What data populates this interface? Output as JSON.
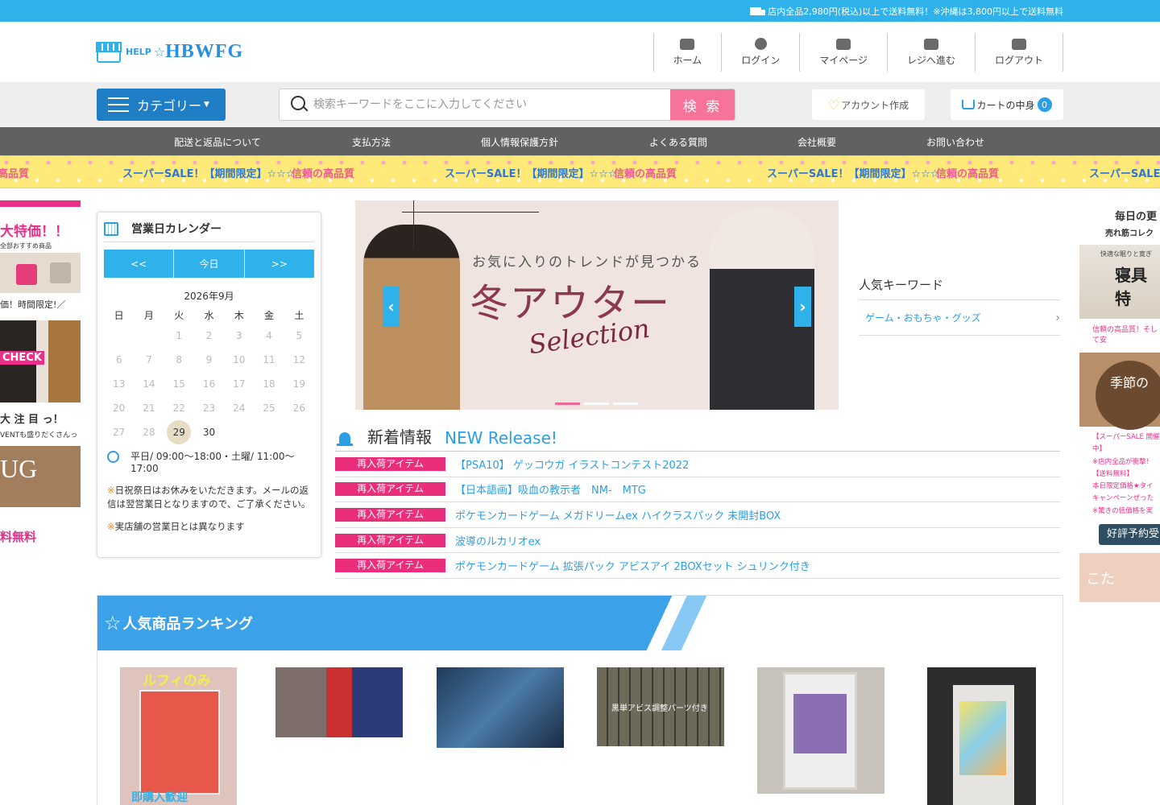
{
  "topbar": {
    "notice": "店内全品2,980円(税込)以上で送料無料！※沖縄は3,800円以上で送料無料"
  },
  "logo": {
    "help": "HELP",
    "star": "☆",
    "brand": "HBWFG"
  },
  "header_nav": [
    {
      "label": "ホーム",
      "icon": "home-icon"
    },
    {
      "label": "ログイン",
      "icon": "user-icon"
    },
    {
      "label": "マイページ",
      "icon": "id-card-icon"
    },
    {
      "label": "レジへ進む",
      "icon": "register-icon"
    },
    {
      "label": "ログアウト",
      "icon": "logout-icon"
    }
  ],
  "toolbar": {
    "category_label": "カテゴリー",
    "search_placeholder": "検索キーワードをここに入力してください",
    "search_button": "検 索",
    "account_label": "アカウント作成",
    "cart_label": "カートの中身",
    "cart_count": "0"
  },
  "global_nav": [
    "配送と返品について",
    "支払方法",
    "個人情報保護方針",
    "よくある質問",
    "会社概要",
    "お問い合わせ"
  ],
  "ribbon": {
    "a": "信頼の高品質",
    "b": "スーパーSALE！【期間限定】☆☆☆"
  },
  "left_strip": {
    "t1": "大特価！！",
    "s1": "全部おすすめ商品",
    "t2": "価！時間限定!／",
    "check": "CHECK",
    "t3": "大 注 目 っ！",
    "s2": "VENTも盛りだくさんっ",
    "rug": "UG",
    "free": "料無料"
  },
  "calendar": {
    "title": "営業日カレンダー",
    "prev": "<<",
    "today": "今日",
    "next": ">>",
    "month": "2026年9月",
    "weekdays": [
      "日",
      "月",
      "火",
      "水",
      "木",
      "金",
      "土"
    ],
    "weeks": [
      [
        "",
        "",
        "1",
        "2",
        "3",
        "4",
        "5"
      ],
      [
        "6",
        "7",
        "8",
        "9",
        "10",
        "11",
        "12"
      ],
      [
        "13",
        "14",
        "15",
        "16",
        "17",
        "18",
        "19"
      ],
      [
        "20",
        "21",
        "22",
        "23",
        "24",
        "25",
        "26"
      ],
      [
        "27",
        "28",
        "29",
        "30",
        "",
        "",
        ""
      ]
    ],
    "hours": "平日/ 09:00～18:00・土曜/ 11:00～17:00",
    "note_prefix": "※",
    "note": "日祝祭日はお休みをいただきます。メールの返信は翌営業日となりますので、ご了承ください。",
    "note2": "実店舗の営業日とは異なります"
  },
  "banner": {
    "sub": "お気に入りのトレンドが見つかる",
    "title": "冬アウター",
    "script": "Selection",
    "prev": "‹",
    "next": "›",
    "active_slide": 1,
    "slide_count": 3
  },
  "keywords": {
    "title": "人気キーワード",
    "items": [
      "ゲーム・おもちゃ・グッズ"
    ],
    "chevron": "›"
  },
  "news": {
    "title": "新着情報",
    "subtitle": "NEW Release!",
    "items": [
      {
        "tag": "再入荷アイテム",
        "text": "【PSA10】 ゲッコウガ イラストコンテスト2022"
      },
      {
        "tag": "再入荷アイテム",
        "text": "【日本語画】吸血の教示者　NM-　MTG"
      },
      {
        "tag": "再入荷アイテム",
        "text": "ポケモンカードゲーム メガドリームex ハイクラスパック 未開封BOX"
      },
      {
        "tag": "再入荷アイテム",
        "text": "波導のルカリオex"
      },
      {
        "tag": "再入荷アイテム",
        "text": "ポケモンカードゲーム 拡張パック アビスアイ 2BOXセット シュリンク付き"
      }
    ]
  },
  "right_strip": {
    "t": "毎日の更",
    "s": "売れ筋コレク",
    "img1_small": "快適な眠りと寛ぎ",
    "img1_big": "寝具特",
    "red1": "信頼の高品質！そして安",
    "circle": "季節の",
    "list": [
      "【スーパーSALE 開催中】",
      "※店内全品が衝撃！",
      "【送料無料】",
      "本日限定価格★タイ",
      "キャンペーンぜった",
      "※驚きの低価格を実"
    ],
    "btn": "好評予約受",
    "img3": "こた"
  },
  "ranking": {
    "title": "人気商品ランキング",
    "p1_label": "ルフィのみ",
    "p1_bottom": "即購入歓迎",
    "p4_label": "黒単アビス調整パーツ付き"
  }
}
